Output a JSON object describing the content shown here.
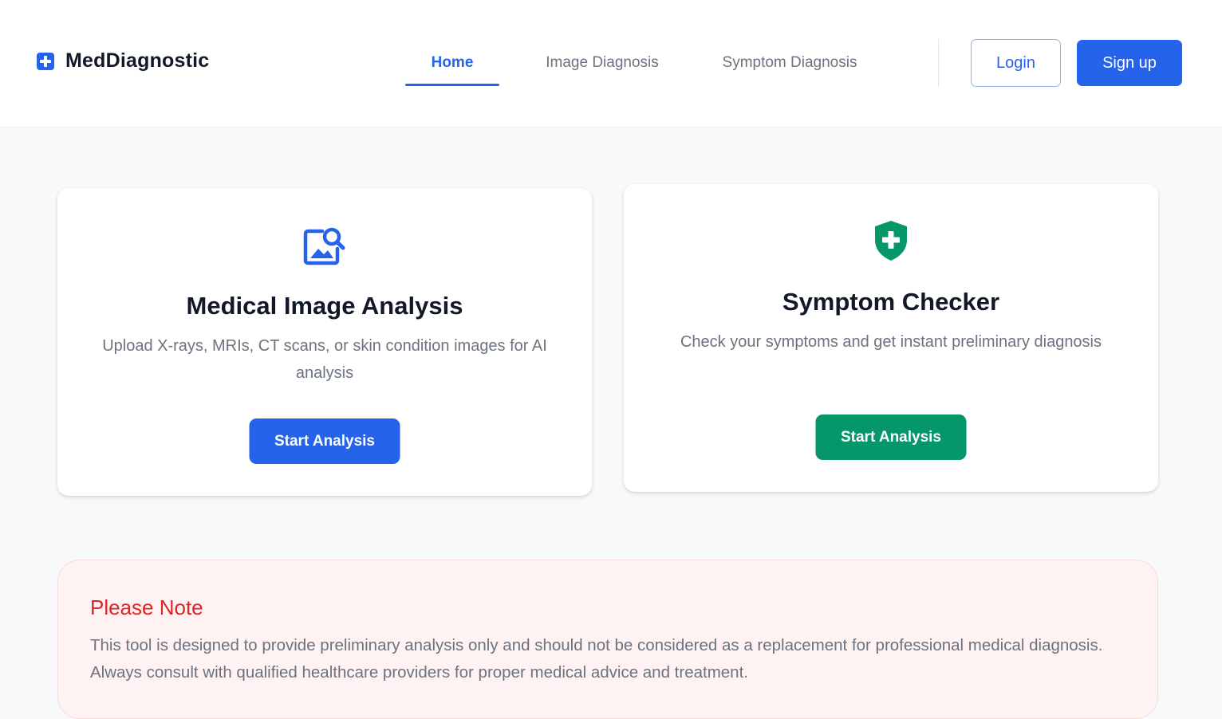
{
  "brand": {
    "name": "MedDiagnostic",
    "icon": "medical-cross-icon",
    "color": "#2563eb"
  },
  "nav": {
    "items": [
      {
        "label": "Home",
        "active": true
      },
      {
        "label": "Image Diagnosis",
        "active": false
      },
      {
        "label": "Symptom Diagnosis",
        "active": false
      }
    ]
  },
  "auth": {
    "login_label": "Login",
    "signup_label": "Sign up"
  },
  "cards": [
    {
      "icon": "image-search-icon",
      "title": "Medical Image Analysis",
      "description": "Upload X-rays, MRIs, CT scans, or skin condition images for AI analysis",
      "button_label": "Start Analysis",
      "accent": "#2563eb"
    },
    {
      "icon": "shield-cross-icon",
      "title": "Symptom Checker",
      "description": "Check your symptoms and get instant preliminary diagnosis",
      "button_label": "Start Analysis",
      "accent": "#059669"
    }
  ],
  "note": {
    "title": "Please Note",
    "text": "This tool is designed to provide preliminary analysis only and should not be considered as a replacement for professional medical diagnosis. Always consult with qualified healthcare providers for proper medical advice and treatment."
  },
  "colors": {
    "primary": "#2563eb",
    "success": "#059669",
    "warning": "#dc2626",
    "note_bg": "#fef2f2"
  }
}
